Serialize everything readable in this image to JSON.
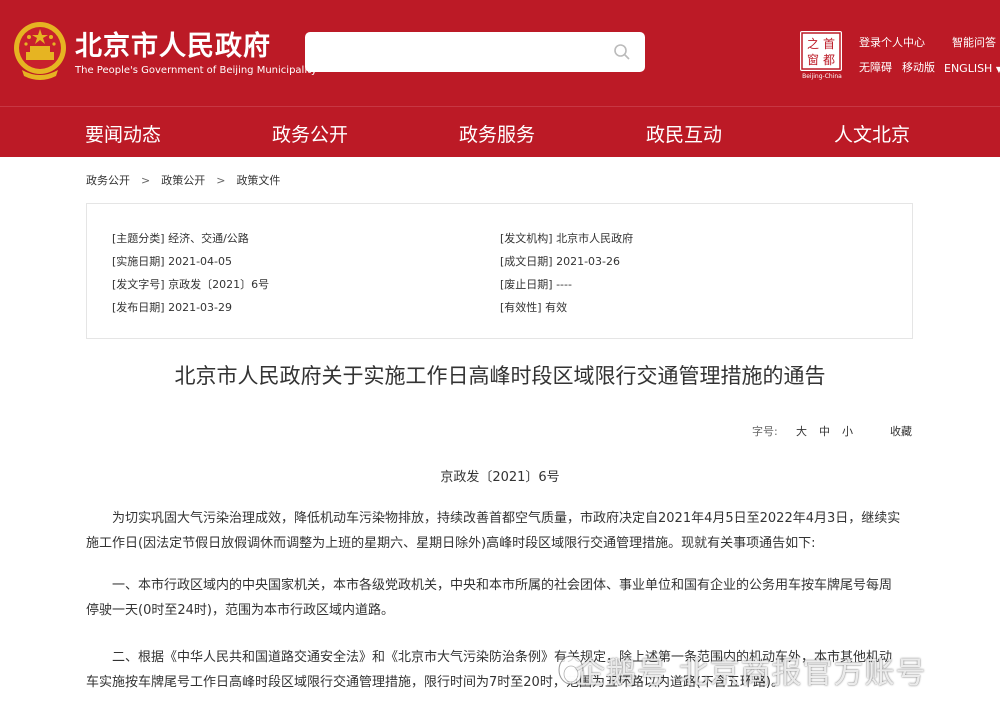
{
  "header": {
    "site_title": "北京市人民政府",
    "site_subtitle": "The People's Government of Beijing Municipality",
    "search_placeholder": "",
    "seal_text": [
      "首",
      "都",
      "之",
      "窗"
    ],
    "seal_caption": "Beijing-China",
    "links": {
      "login": "登录个人中心",
      "qa": "智能问答",
      "accessibility": "无障碍",
      "mobile": "移动版",
      "english": "ENGLISH"
    }
  },
  "nav": [
    "要闻动态",
    "政务公开",
    "政务服务",
    "政民互动",
    "人文北京"
  ],
  "breadcrumb": [
    "政务公开",
    "政策公开",
    "政策文件"
  ],
  "breadcrumb_sep": ">",
  "meta": {
    "left": [
      "[主题分类] 经济、交通/公路",
      "[实施日期] 2021-04-05",
      "[发文字号] 京政发〔2021〕6号",
      "[发布日期] 2021-03-29"
    ],
    "right": [
      "[发文机构] 北京市人民政府",
      "[成文日期] 2021-03-26",
      "[废止日期] ----",
      "[有效性] 有效"
    ]
  },
  "article": {
    "title": "北京市人民政府关于实施工作日高峰时段区域限行交通管理措施的通告",
    "font_size_label": "字号:",
    "font_sizes": [
      "大",
      "中",
      "小"
    ],
    "favorite": "收藏",
    "doc_number": "京政发〔2021〕6号",
    "paragraphs": [
      [
        "为切实巩固大气污染治理成效，降低机动车污染物排放，持续改善首都空气质量，市政府决定自2021年4月5日至2022年4月3日，继续实",
        "施工作日(因法定节假日放假调休而调整为上班的星期六、星期日除外)高峰时段区域限行交通管理措施。现就有关事项通告如下:"
      ],
      [
        "一、本市行政区域内的中央国家机关，本市各级党政机关，中央和本市所属的社会团体、事业单位和国有企业的公务用车按车牌尾号每周",
        "停驶一天(0时至24时)，范围为本市行政区域内道路。"
      ],
      [
        "二、根据《中华人民共和国道路交通安全法》和《北京市大气污染防治条例》有关规定，除上述第一条范围内的机动车外，本市其他机动",
        "车实施按车牌尾号工作日高峰时段区域限行交通管理措施，限行时间为7时至20时，范围为五环路以内道路(不含五环路)。"
      ]
    ]
  },
  "watermark": "企鹅号 北京商报官方账号",
  "colors": {
    "brand_red": "#bc1a26",
    "text": "#333333",
    "border": "#e5e5e5"
  }
}
